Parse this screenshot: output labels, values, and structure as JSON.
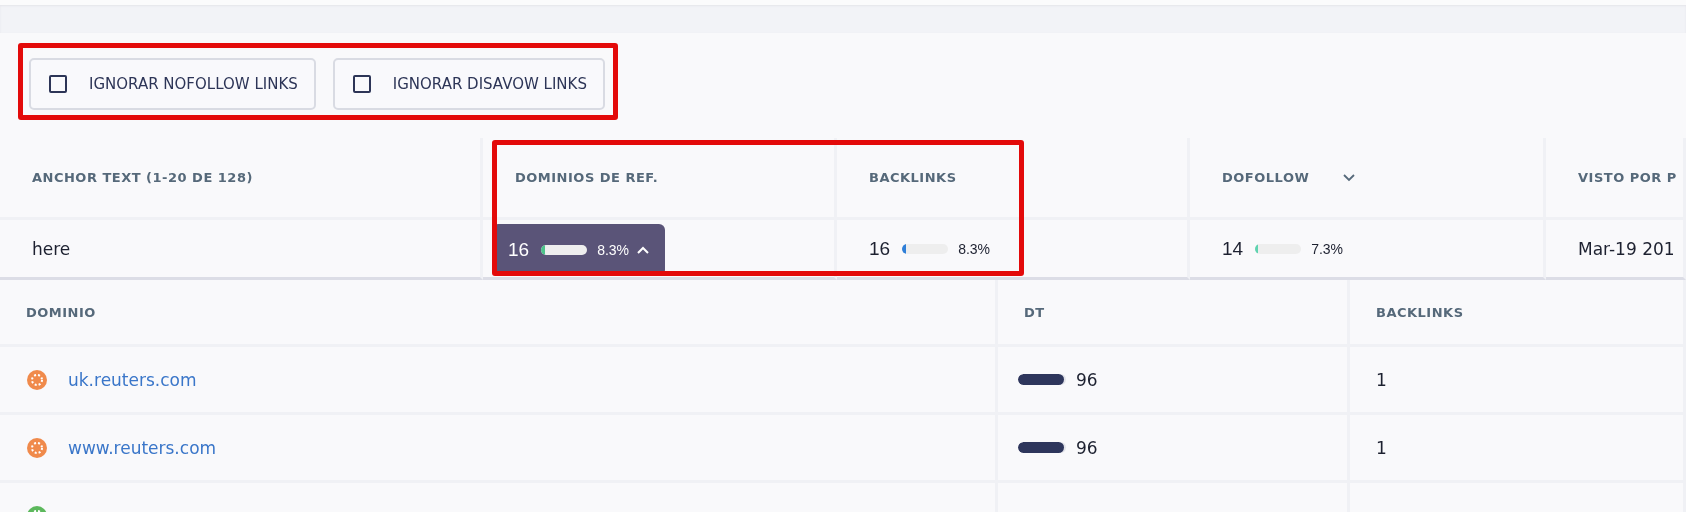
{
  "filters": {
    "highlighted": true,
    "items": [
      {
        "label": "IGNORAR NOFOLLOW LINKS",
        "checked": false
      },
      {
        "label": "IGNORAR DISAVOW LINKS",
        "checked": false
      }
    ]
  },
  "table": {
    "columns": [
      {
        "label": "ANCHOR TEXT (1-20 DE 128)",
        "sorted": false,
        "highlighted": false
      },
      {
        "label": "DOMINIOS DE REF.",
        "sorted": false,
        "highlighted": true
      },
      {
        "label": "BACKLINKS",
        "sorted": false,
        "highlighted": true
      },
      {
        "label": "DOFOLLOW",
        "sorted": true,
        "highlighted": false
      },
      {
        "label": "VISTO POR P",
        "sorted": false,
        "highlighted": false
      }
    ],
    "rows": [
      {
        "cells": [
          {
            "kind": "text",
            "text": "here"
          },
          {
            "kind": "metric",
            "value": "16",
            "level": 0.083,
            "percent": "8.3%",
            "color": "#4cc38a",
            "expanded": true
          },
          {
            "kind": "metric",
            "value": "16",
            "level": 0.083,
            "percent": "8.3%",
            "color": "#2f7fd8",
            "expanded": false
          },
          {
            "kind": "metric",
            "value": "14",
            "level": 0.073,
            "percent": "7.3%",
            "color": "#5fd3b0",
            "expanded": false
          },
          {
            "kind": "text",
            "text": "Mar-19 201"
          }
        ]
      }
    ]
  },
  "domains": {
    "columns": [
      "DOMINIO",
      "DT",
      "BACKLINKS"
    ],
    "rows": [
      {
        "domain": "uk.reuters.com",
        "color": "#f08a4b",
        "dt": "96",
        "level": 0.96,
        "backlinks": "1"
      },
      {
        "domain": "www.reuters.com",
        "color": "#f08a4b",
        "dt": "96",
        "level": 0.96,
        "backlinks": "1"
      },
      {
        "color": "#5cb85c"
      }
    ]
  }
}
